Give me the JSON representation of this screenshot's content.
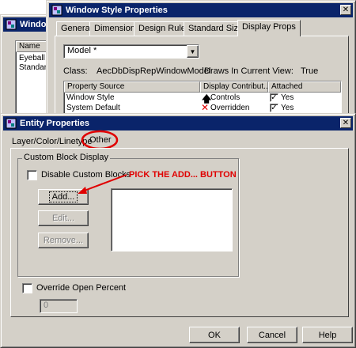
{
  "back_window": {
    "title": "Windo",
    "list_header": "Name",
    "list_items": [
      "Eyeball",
      "Standard"
    ]
  },
  "style_window": {
    "title": "Window Style Properties",
    "tabs": [
      "General",
      "Dimensions",
      "Design Rules",
      "Standard Sizes",
      "Display Props"
    ],
    "active_tab": "Display Props",
    "dropdown_value": "Model *",
    "class_label": "Class:",
    "class_value": "AecDbDispRepWindowModel",
    "draws_label": "Draws In Current View:",
    "draws_value": "True",
    "table": {
      "headers": [
        "Property Source",
        "Display Contribut...",
        "Attached"
      ],
      "rows": [
        {
          "source": "Window Style",
          "contribution": "Controls",
          "attached": "Yes"
        },
        {
          "source": "System Default",
          "contribution": "Overridden",
          "attached": "Yes"
        }
      ]
    }
  },
  "entity_window": {
    "title": "Entity Properties",
    "tabs": [
      "Layer/Color/Linetype",
      "Other"
    ],
    "active_tab": "Other",
    "group_label": "Custom Block Display",
    "disable_custom_blocks": {
      "label": "Disable Custom Blocks",
      "checked": false
    },
    "buttons": {
      "add": "Add...",
      "edit": "Edit...",
      "remove": "Remove..."
    },
    "override_open_percent": {
      "label": "Override Open Percent",
      "checked": false,
      "value": "0"
    },
    "footer_buttons": {
      "ok": "OK",
      "cancel": "Cancel",
      "help": "Help"
    }
  },
  "annotation": {
    "text": "PICK THE ADD... BUTTON",
    "color": "#e00000"
  },
  "colors": {
    "titlebar": "#0a246a",
    "face": "#d4d0c8"
  }
}
